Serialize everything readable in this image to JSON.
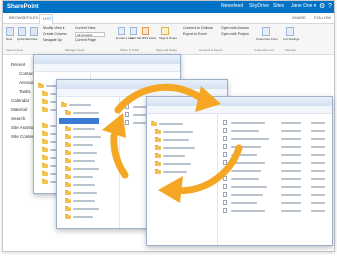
{
  "app": {
    "title": "SharePoint",
    "top_links": [
      "Newsfeed",
      "SkyDrive",
      "Sites"
    ],
    "user": "Jane Doe ▾"
  },
  "ribbon": {
    "tabs": [
      "BROWSE",
      "FILES",
      "LIST"
    ],
    "right_actions": [
      "SHARE",
      "FOLLOW"
    ],
    "buttons": [
      "New",
      "Quick Edit",
      "View",
      "Modify View ▾",
      "Create Column",
      "Navigate Up",
      "Current View:",
      "All contacts",
      "Current Page",
      "E-mail a Link",
      "Alert Me",
      "RSS Feed",
      "Tags & Notes",
      "Connect to Outlook",
      "Export to Excel",
      "Open with Access",
      "Open with Project",
      "Customize Form",
      "List Settings"
    ],
    "groups": [
      "View Format",
      "Manage Views",
      "Share & Track",
      "Tags and Notes",
      "Connect & Export",
      "Customize List",
      "Settings"
    ]
  },
  "nav": {
    "items": [
      "Recent",
      "Contacts",
      "Announcements",
      "Tasks",
      "Calendar",
      "Material",
      "Search",
      "Site Assistance Blog",
      "Site Contents"
    ]
  },
  "colors": {
    "suite_bar": "#0072c6",
    "accent": "#0072c6",
    "sync_arrows": "#f5a623",
    "folder": "#f2c14e",
    "selection": "#3a7bd5"
  },
  "icons": [
    "sync-arrows-icon",
    "folder-icon",
    "document-icon",
    "gear-icon",
    "help-icon"
  ]
}
